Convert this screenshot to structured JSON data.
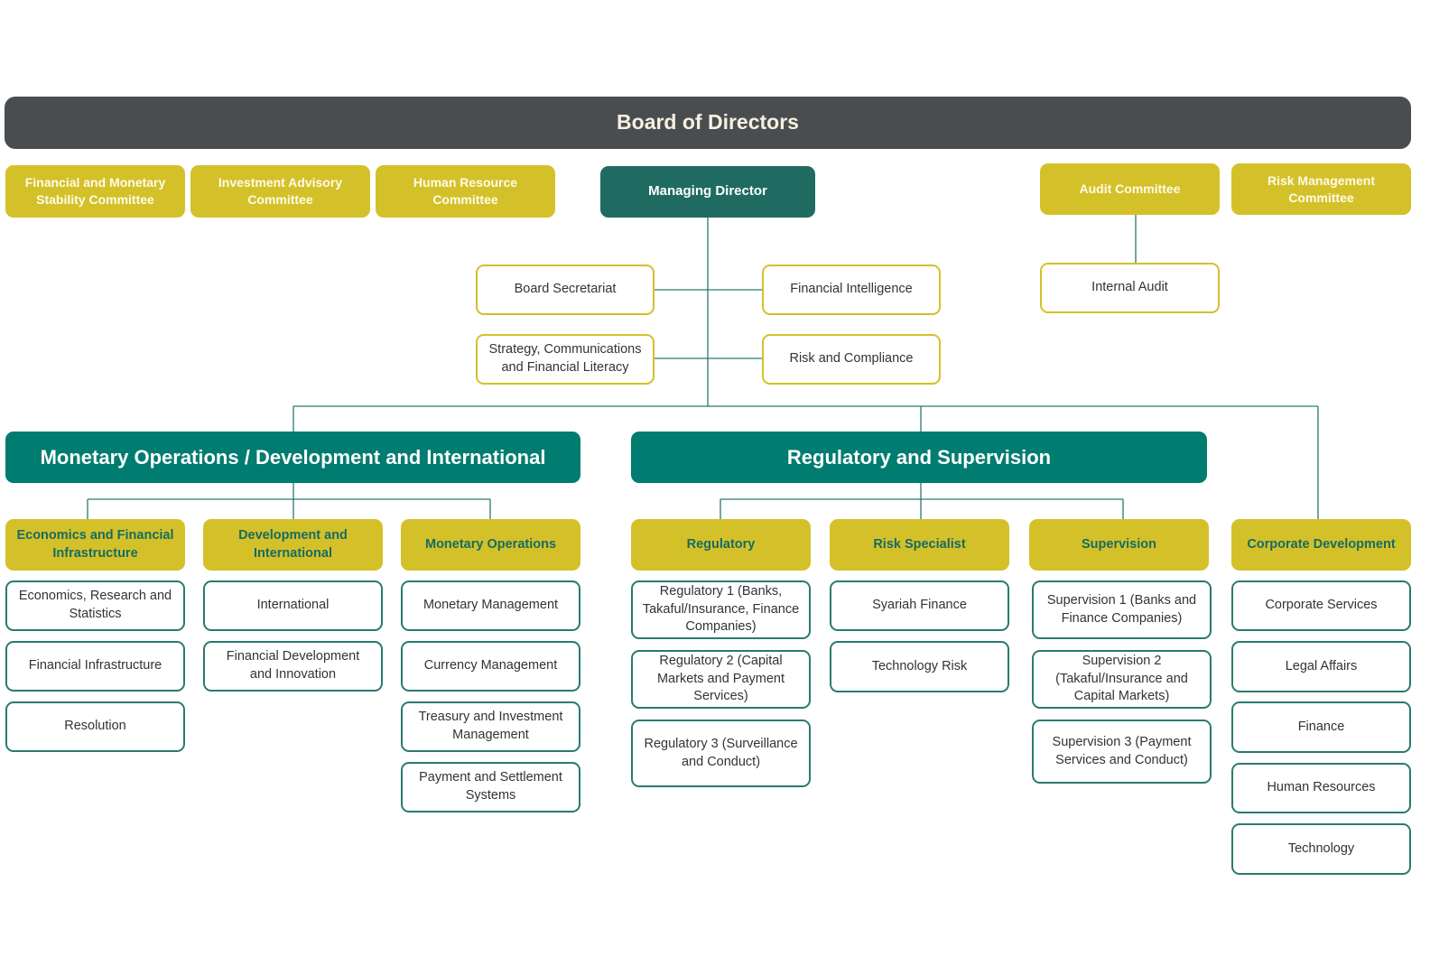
{
  "colors": {
    "board": "#4a4d50",
    "committee": "#d4c12a",
    "managing_director": "#1f6b62",
    "section": "#007c70",
    "line": "#2a7a6e"
  },
  "board": "Board of Directors",
  "committees": [
    "Financial and Monetary Stability Committee",
    "Investment Advisory Committee",
    "Human Resource Committee"
  ],
  "managing_director": "Managing Director",
  "right_committees": [
    "Audit Committee",
    "Risk Management Committee"
  ],
  "internal_audit": "Internal Audit",
  "md_units": [
    "Board Secretariat",
    "Financial Intelligence",
    "Strategy, Communications and Financial Literacy",
    "Risk and Compliance"
  ],
  "sections": [
    "Monetary Operations / Development and International",
    "Regulatory and Supervision"
  ],
  "departments": [
    {
      "title": "Economics and Financial Infrastructure",
      "items": [
        "Economics, Research and Statistics",
        "Financial Infrastructure",
        "Resolution"
      ]
    },
    {
      "title": "Development and International",
      "items": [
        "International",
        "Financial Development and Innovation"
      ]
    },
    {
      "title": "Monetary Operations",
      "items": [
        "Monetary Management",
        "Currency Management",
        "Treasury and Investment Management",
        "Payment and Settlement Systems"
      ]
    },
    {
      "title": "Regulatory",
      "items": [
        "Regulatory 1 (Banks, Takaful/Insurance, Finance Companies)",
        "Regulatory 2 (Capital Markets and Payment Services)",
        "Regulatory 3 (Surveillance and Conduct)"
      ]
    },
    {
      "title": "Risk Specialist",
      "items": [
        "Syariah Finance",
        "Technology Risk"
      ]
    },
    {
      "title": "Supervision",
      "items": [
        "Supervision 1 (Banks and Finance Companies)",
        "Supervision 2 (Takaful/Insurance and Capital Markets)",
        "Supervision 3 (Payment Services and Conduct)"
      ]
    },
    {
      "title": "Corporate Development",
      "items": [
        "Corporate Services",
        "Legal Affairs",
        "Finance",
        "Human Resources",
        "Technology"
      ]
    }
  ]
}
